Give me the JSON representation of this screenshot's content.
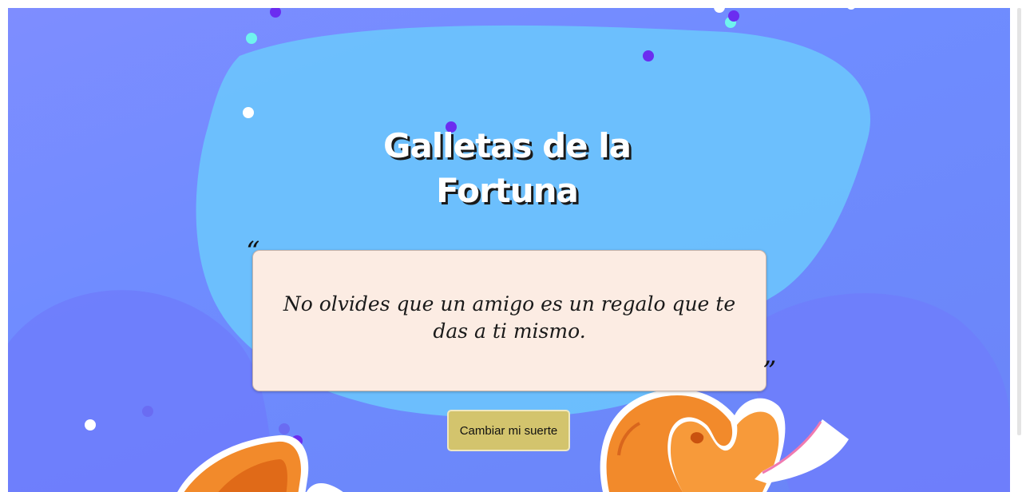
{
  "header": {
    "title_line1": "Galletas de la",
    "title_line2": "Fortuna"
  },
  "fortune": {
    "open_quote": "“",
    "close_quote": "”",
    "text": "No olvides que un amigo es un regalo que te das a ti mismo."
  },
  "actions": {
    "change_luck_label": "Cambiar mi suerte"
  },
  "colors": {
    "background": "#6f8cff",
    "blob": "#6cc4fd",
    "card": "#fcece3",
    "button": "#d3c46d",
    "dot_purple": "#6b2df0",
    "dot_cyan": "#6ff3ee",
    "dot_white": "#ffffff",
    "cookie_orange": "#f28a2b"
  },
  "icons": [
    "fortune-cookie-icon",
    "confetti-dot"
  ]
}
